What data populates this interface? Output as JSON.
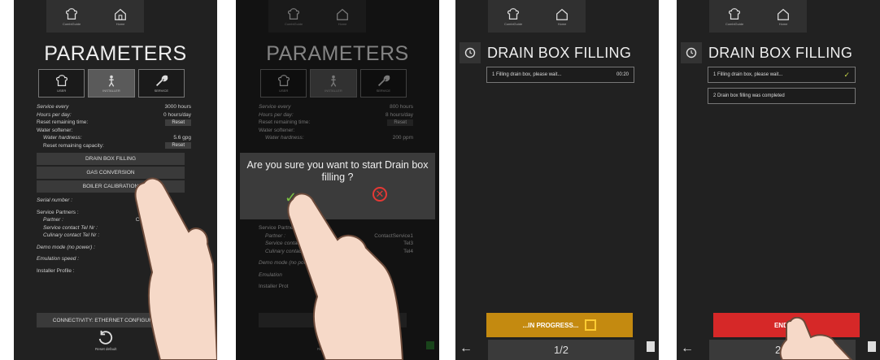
{
  "panels": [
    {
      "topbar": {
        "combiguide": "CombiGuide",
        "home": "Home"
      },
      "title": "PARAMETERS",
      "tabs": {
        "user": "USER",
        "installer": "INSTALLER",
        "service": "SERVICE"
      },
      "rows": [
        {
          "k": "Service every",
          "v": "3000 hours"
        },
        {
          "k": "Hours per day:",
          "v": "0 hours/day"
        },
        {
          "k": "Reset remaining time:",
          "btn": "Reset"
        },
        {
          "k": "Water softener:",
          "v": ""
        },
        {
          "k": "Water hardness:",
          "v": "5.6 gpg"
        },
        {
          "k": "Reset remaining capacity:",
          "btn": "Reset"
        }
      ],
      "buttons": {
        "drain": "DRAIN BOX FILLING",
        "gas": "GAS CONVERSION",
        "boiler": "BOILER CALIBRATION"
      },
      "serial": "Serial number :",
      "partners": {
        "label": "Service Partners :",
        "partner": "Partner :",
        "contact": "Service contact Tel Nr :",
        "culinary": "Culinary contact Tel Nr :",
        "partner_val": "Co"
      },
      "demo": "Demo mode (no power) :",
      "emulation": "Emulation speed :",
      "installer_profile": "Installer Profile :",
      "connectivity": "CONNECTIVITY: ETHERNET CONFIGURATION",
      "reset_default": "Reset default"
    },
    {
      "topbar": {
        "combiguide": "CombiGuide",
        "home": "Home"
      },
      "title": "PARAMETERS",
      "tabs": {
        "user": "USER",
        "installer": "INSTALLER",
        "service": "SERVICE"
      },
      "rows": [
        {
          "k": "Service every",
          "v": "800 hours"
        },
        {
          "k": "Hours per day:",
          "v": "8 hours/day"
        },
        {
          "k": "Reset remaining time:",
          "btn": "Reset"
        },
        {
          "k": "Water softener:",
          "v": ""
        },
        {
          "k": "Water hardness:",
          "v": "200 ppm"
        }
      ],
      "dialog": {
        "question": "Are you sure you want to start Drain box filling ?"
      },
      "partners": {
        "label": "Service Partners :",
        "partner": "Partner :",
        "contact": "Service contact Tel Nr",
        "culinary": "Culinary contact Tel N",
        "partner_val": "ContactService1",
        "tel3": "Tel3",
        "tel4": "Tel4"
      },
      "demo": "Demo mode (no power",
      "emulation": "Emulation",
      "installer_profile": "Installer Prot",
      "connectivity": "CONNECTIVI",
      "reset_default": "Reset default"
    },
    {
      "topbar": {
        "combiguide": "CombiGuide",
        "home": "Home"
      },
      "title": "DRAIN BOX FILLING",
      "steps": [
        {
          "text": "1  Filling drain box, please wait...",
          "time": "00:20"
        }
      ],
      "progress": "...IN PROGRESS...",
      "pager": "1/2"
    },
    {
      "topbar": {
        "combiguide": "CombiGuide",
        "home": "Home"
      },
      "title": "DRAIN BOX FILLING",
      "steps": [
        {
          "text": "1  Filling drain box, please wait..."
        },
        {
          "text": "2  Drain box filling was completed"
        }
      ],
      "end": "END",
      "pager": "2/2"
    }
  ],
  "colors": {
    "bg": "#212121",
    "progress": "#c48a10",
    "end": "#d62828",
    "ok": "#7cc242",
    "cancel": "#e53935"
  }
}
